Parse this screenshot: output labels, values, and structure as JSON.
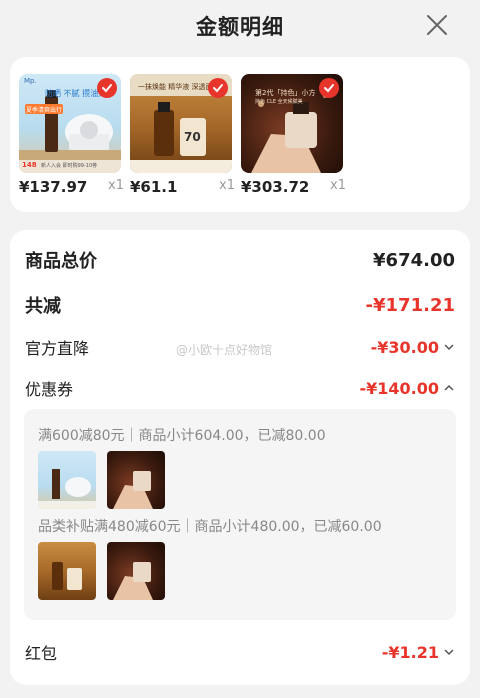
{
  "header": {
    "title": "金额明细"
  },
  "products": [
    {
      "price": "¥137.97",
      "qty": "x1",
      "thumb": "electronic mosquito repellent product photo"
    },
    {
      "price": "¥61.1",
      "qty": "x1",
      "thumb": "essence oil bottle product photo"
    },
    {
      "price": "¥303.72",
      "qty": "x1",
      "thumb": "perfume bottle product photo"
    }
  ],
  "summary": {
    "total_label": "商品总价",
    "total_value": "¥674.00",
    "discount_label": "共减",
    "discount_value": "-¥171.21",
    "official_label": "官方直降",
    "official_value": "-¥30.00",
    "coupon_label": "优惠券",
    "coupon_value": "-¥140.00",
    "redpacket_label": "红包",
    "redpacket_value": "-¥1.21"
  },
  "coupons": [
    {
      "text": "满600减80元｜商品小计604.00，已减80.00"
    },
    {
      "text": "品类补贴满480减60元｜商品小计480.00，已减60.00"
    }
  ],
  "thumb_text": {
    "p1_brand": "Mp.",
    "p1_tag": "防晒 不腻 攒油无",
    "p1_badge": "夏季清爽出行",
    "p1_price": "148",
    "p1_promo": "新人入会 即时购99-10券",
    "p2_banner": "一抹焕能 精华液 深透面",
    "p2_badge": "70",
    "p3_banner": "第2代「持色」小方",
    "p3_sub": "持色 CLE 全天候赋美"
  },
  "watermark": "@小欧十点好物馆",
  "colors": {
    "accent_red": "#e8352c",
    "card_bg": "#ffffff",
    "page_bg": "#f2f2f2"
  },
  "icons": {
    "close": "close-icon",
    "check": "check-icon",
    "chevron_down": "chevron-down-icon",
    "chevron_up": "chevron-up-icon"
  }
}
